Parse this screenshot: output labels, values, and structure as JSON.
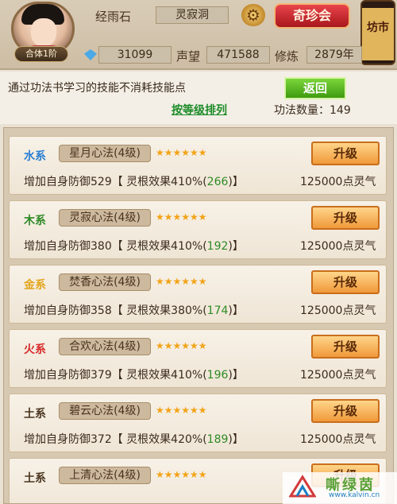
{
  "header": {
    "rank_badge": "合体1阶",
    "jingyu_label": "经雨石",
    "location": "灵寂洞",
    "treasure_button": "奇珍会",
    "lantern_label": "坊市",
    "gems": "31099",
    "reputation_label": "声望",
    "reputation": "471588",
    "cultivation_label": "修炼",
    "cultivation": "2879年"
  },
  "info": {
    "message": "通过功法书学习的技能不消耗技能点",
    "return_button": "返回",
    "sort_link": "按等级排列",
    "count_text": "功法数量：149"
  },
  "skills": [
    {
      "element": "水系",
      "element_color": "#2b7fd3",
      "name": "星月心法(4级)",
      "stars": "★★★★★★",
      "upgrade": "升级",
      "desc_a": "增加自身防御529【 灵根效果410%(",
      "bonus": "266",
      "desc_b": ")】",
      "cost": "125000点灵气"
    },
    {
      "element": "木系",
      "element_color": "#2f8a26",
      "name": "灵寂心法(4级)",
      "stars": "★★★★★★",
      "upgrade": "升级",
      "desc_a": "增加自身防御380【 灵根效果410%(",
      "bonus": "192",
      "desc_b": ")】",
      "cost": "125000点灵气"
    },
    {
      "element": "金系",
      "element_color": "#e3a51a",
      "name": "焚香心法(4级)",
      "stars": "★★★★★★",
      "upgrade": "升级",
      "desc_a": "增加自身防御358【 灵根效果380%(",
      "bonus": "174",
      "desc_b": ")】",
      "cost": "125000点灵气"
    },
    {
      "element": "火系",
      "element_color": "#d62a2a",
      "name": "合欢心法(4级)",
      "stars": "★★★★★★",
      "upgrade": "升级",
      "desc_a": "增加自身防御379【 灵根效果410%(",
      "bonus": "196",
      "desc_b": ")】",
      "cost": "125000点灵气"
    },
    {
      "element": "土系",
      "element_color": "#4a3520",
      "name": "碧云心法(4级)",
      "stars": "★★★★★★",
      "upgrade": "升级",
      "desc_a": "增加自身防御372【 灵根效果420%(",
      "bonus": "189",
      "desc_b": ")】",
      "cost": "125000点灵气"
    },
    {
      "element": "土系",
      "element_color": "#4a3520",
      "name": "上清心法(4级)",
      "stars": "★★★★★★",
      "upgrade": "升级",
      "desc_a": "",
      "bonus": "",
      "desc_b": "",
      "cost": ""
    }
  ],
  "watermark": {
    "title": "嘶绿茵",
    "url": "www.kalvin.cn"
  }
}
